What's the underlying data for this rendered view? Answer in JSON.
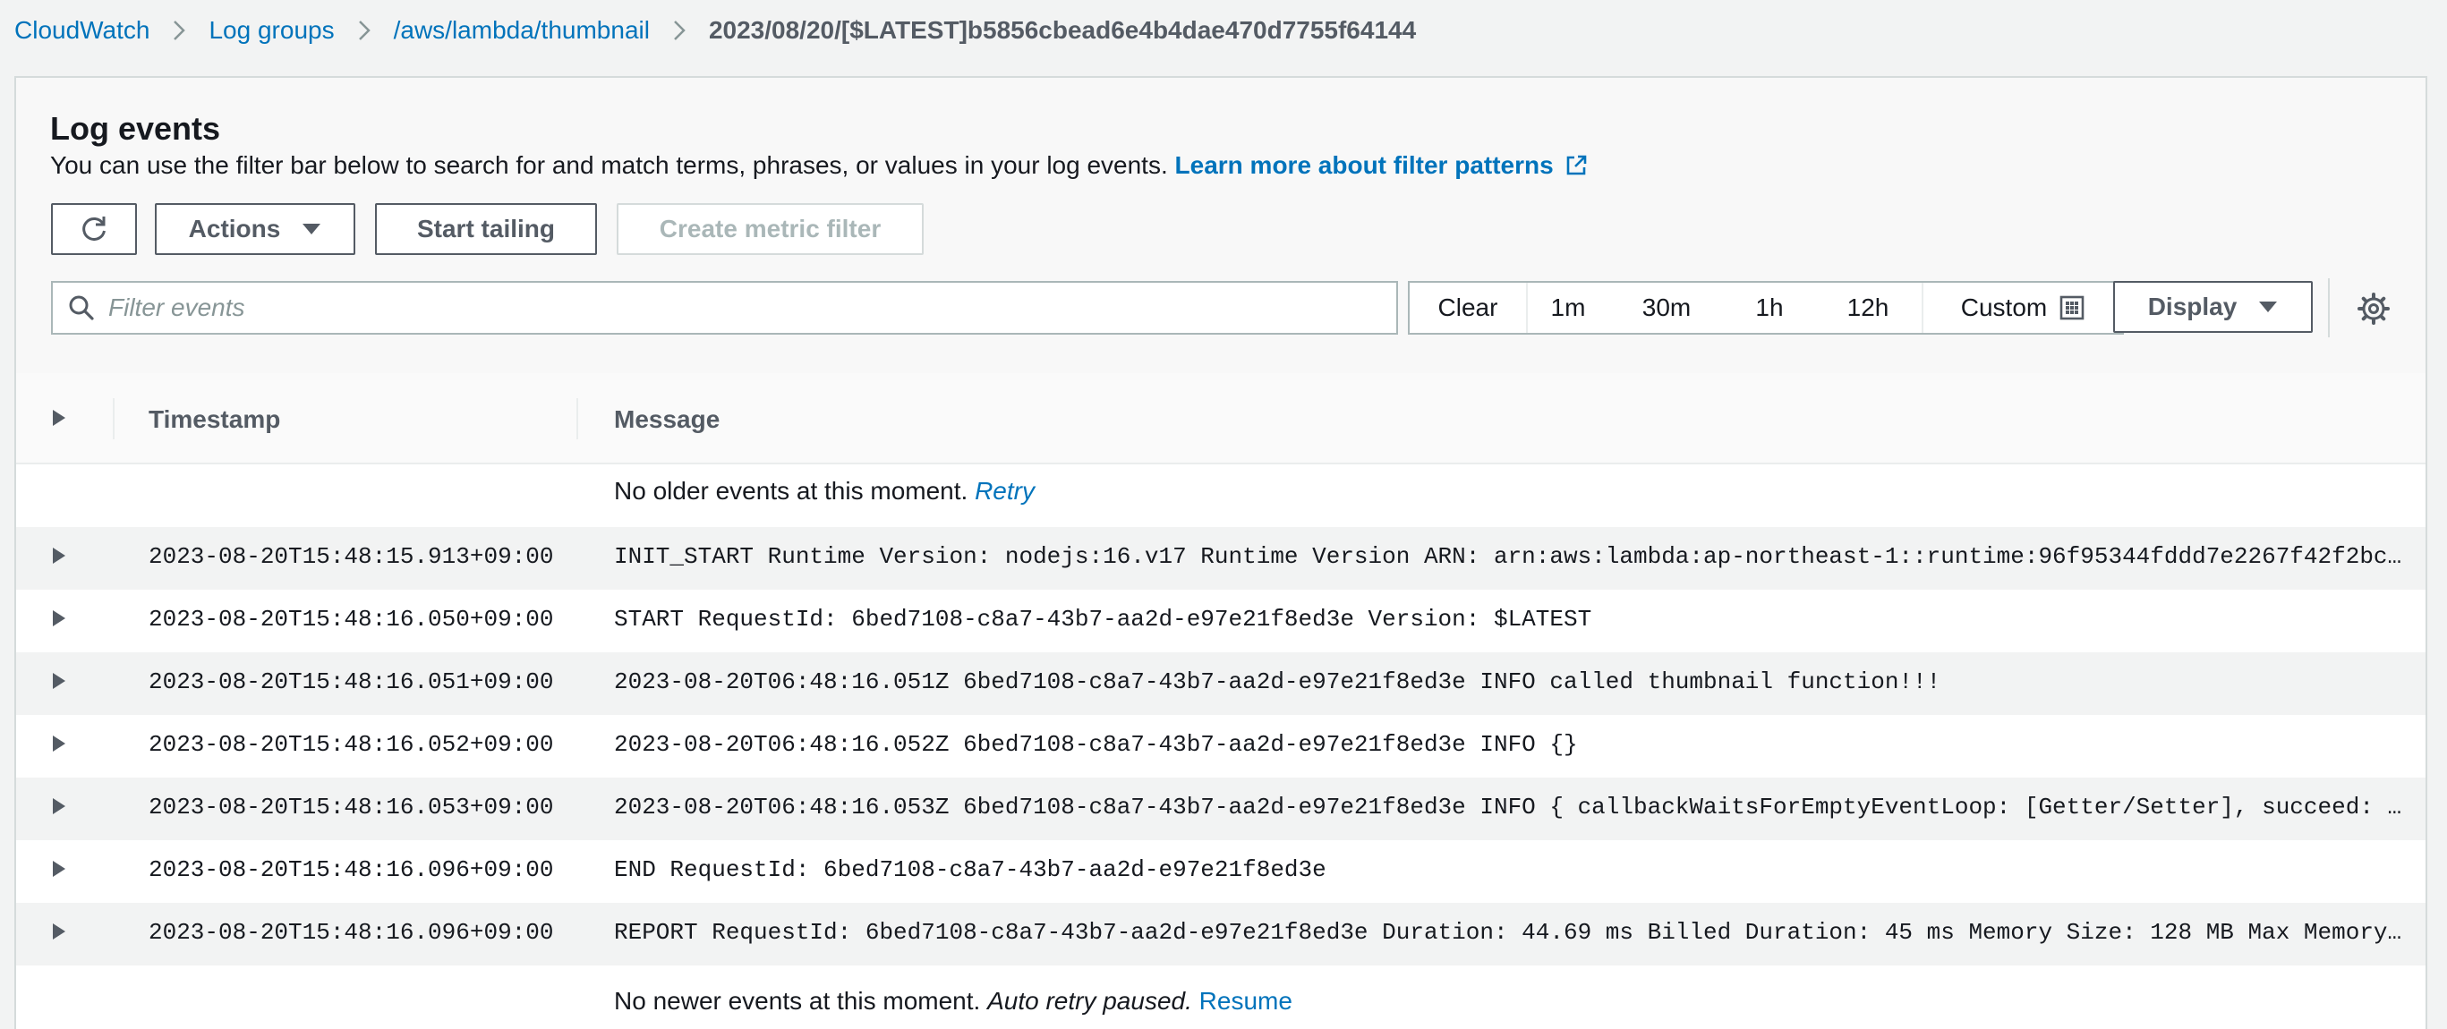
{
  "breadcrumb": {
    "items": [
      {
        "label": "CloudWatch"
      },
      {
        "label": "Log groups"
      },
      {
        "label": "/aws/lambda/thumbnail"
      }
    ],
    "current": "2023/08/20/[$LATEST]b5856cbead6e4b4dae470d7755f64144"
  },
  "panel": {
    "title": "Log events",
    "description": "You can use the filter bar below to search for and match terms, phrases, or values in your log events.",
    "learn_more": "Learn more about filter patterns"
  },
  "toolbar": {
    "actions_label": "Actions",
    "start_tailing_label": "Start tailing",
    "create_metric_filter_label": "Create metric filter"
  },
  "filter": {
    "placeholder": "Filter events",
    "value": ""
  },
  "time_range": {
    "options": [
      "Clear",
      "1m",
      "30m",
      "1h",
      "12h",
      "Custom"
    ]
  },
  "display_label": "Display",
  "table": {
    "columns": [
      "Timestamp",
      "Message"
    ],
    "older_notice": "No older events at this moment.",
    "older_retry": "Retry",
    "newer_notice": "No newer events at this moment.",
    "newer_paused": "Auto retry paused.",
    "newer_resume": "Resume",
    "rows": [
      {
        "timestamp": "2023-08-20T15:48:15.913+09:00",
        "message": "INIT_START Runtime Version: nodejs:16.v17 Runtime Version ARN: arn:aws:lambda:ap-northeast-1::runtime:96f95344fddd7e2267f42f2bcf8be9879aa..."
      },
      {
        "timestamp": "2023-08-20T15:48:16.050+09:00",
        "message": "START RequestId: 6bed7108-c8a7-43b7-aa2d-e97e21f8ed3e Version: $LATEST"
      },
      {
        "timestamp": "2023-08-20T15:48:16.051+09:00",
        "message": "2023-08-20T06:48:16.051Z 6bed7108-c8a7-43b7-aa2d-e97e21f8ed3e INFO called thumbnail function!!!"
      },
      {
        "timestamp": "2023-08-20T15:48:16.052+09:00",
        "message": "2023-08-20T06:48:16.052Z 6bed7108-c8a7-43b7-aa2d-e97e21f8ed3e INFO {}"
      },
      {
        "timestamp": "2023-08-20T15:48:16.053+09:00",
        "message": "2023-08-20T06:48:16.053Z 6bed7108-c8a7-43b7-aa2d-e97e21f8ed3e INFO { callbackWaitsForEmptyEventLoop: [Getter/Setter], succeed: [Function ..."
      },
      {
        "timestamp": "2023-08-20T15:48:16.096+09:00",
        "message": "END RequestId: 6bed7108-c8a7-43b7-aa2d-e97e21f8ed3e"
      },
      {
        "timestamp": "2023-08-20T15:48:16.096+09:00",
        "message": "REPORT RequestId: 6bed7108-c8a7-43b7-aa2d-e97e21f8ed3e Duration: 44.69 ms Billed Duration: 45 ms Memory Size: 128 MB Max Memory Used: 58 ..."
      }
    ]
  },
  "icons": [
    "refresh-icon",
    "caret-down-icon",
    "search-icon",
    "calendar-icon",
    "gear-icon",
    "expand-arrow-icon",
    "external-link-icon",
    "chevron-right-icon"
  ],
  "colors": {
    "link": "#0073bb",
    "border": "#545b64",
    "disabled": "#aab7b8",
    "row_shade": "#f2f3f3"
  }
}
